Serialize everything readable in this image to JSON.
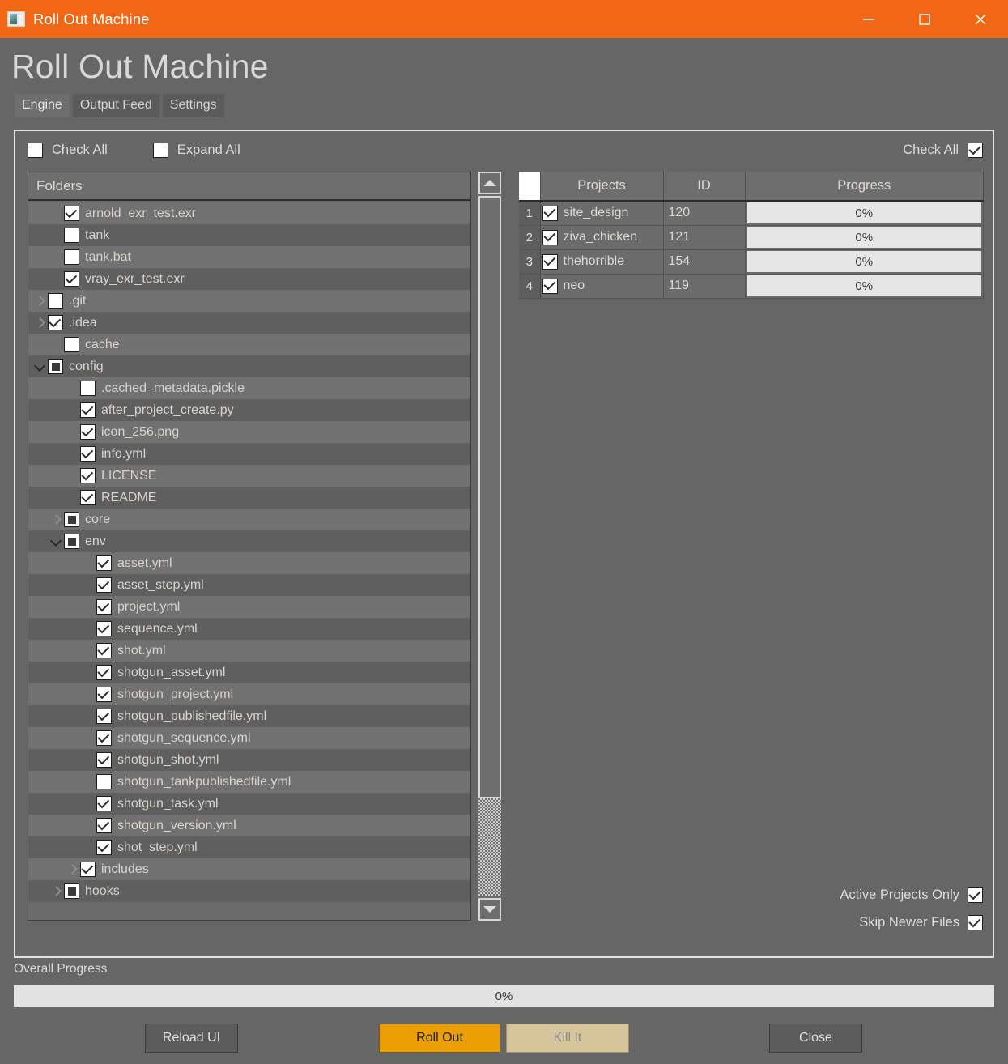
{
  "window": {
    "title": "Roll Out Machine",
    "icon": "app-window-icon",
    "controls": {
      "minimize": "minimize-icon",
      "maximize": "maximize-icon",
      "close": "close-icon"
    },
    "accent_color": "#f26716"
  },
  "header": {
    "app_title": "Roll Out Machine"
  },
  "tabs": [
    {
      "label": "Engine",
      "active": true
    },
    {
      "label": "Output Feed",
      "active": false
    },
    {
      "label": "Settings",
      "active": false
    }
  ],
  "left_panel": {
    "check_all_label": "Check All",
    "check_all_state": "unchecked",
    "expand_all_label": "Expand All",
    "expand_all_state": "unchecked",
    "tree_header": "Folders",
    "rows": [
      {
        "label": "arnold_exr_test.exr",
        "indent": 1,
        "arrow": "none",
        "check": "checked"
      },
      {
        "label": "tank",
        "indent": 1,
        "arrow": "none",
        "check": "unchecked"
      },
      {
        "label": "tank.bat",
        "indent": 1,
        "arrow": "none",
        "check": "unchecked"
      },
      {
        "label": "vray_exr_test.exr",
        "indent": 1,
        "arrow": "none",
        "check": "checked"
      },
      {
        "label": ".git",
        "indent": 0,
        "arrow": "right",
        "check": "unchecked"
      },
      {
        "label": ".idea",
        "indent": 0,
        "arrow": "right",
        "check": "checked"
      },
      {
        "label": "cache",
        "indent": 1,
        "arrow": "none",
        "check": "unchecked"
      },
      {
        "label": "config",
        "indent": 0,
        "arrow": "down",
        "check": "partial"
      },
      {
        "label": ".cached_metadata.pickle",
        "indent": 2,
        "arrow": "none",
        "check": "unchecked"
      },
      {
        "label": "after_project_create.py",
        "indent": 2,
        "arrow": "none",
        "check": "checked"
      },
      {
        "label": "icon_256.png",
        "indent": 2,
        "arrow": "none",
        "check": "checked"
      },
      {
        "label": "info.yml",
        "indent": 2,
        "arrow": "none",
        "check": "checked"
      },
      {
        "label": "LICENSE",
        "indent": 2,
        "arrow": "none",
        "check": "checked"
      },
      {
        "label": "README",
        "indent": 2,
        "arrow": "none",
        "check": "checked"
      },
      {
        "label": "core",
        "indent": 1,
        "arrow": "right",
        "check": "partial"
      },
      {
        "label": "env",
        "indent": 1,
        "arrow": "down",
        "check": "partial"
      },
      {
        "label": "asset.yml",
        "indent": 3,
        "arrow": "none",
        "check": "checked"
      },
      {
        "label": "asset_step.yml",
        "indent": 3,
        "arrow": "none",
        "check": "checked"
      },
      {
        "label": "project.yml",
        "indent": 3,
        "arrow": "none",
        "check": "checked"
      },
      {
        "label": "sequence.yml",
        "indent": 3,
        "arrow": "none",
        "check": "checked"
      },
      {
        "label": "shot.yml",
        "indent": 3,
        "arrow": "none",
        "check": "checked"
      },
      {
        "label": "shotgun_asset.yml",
        "indent": 3,
        "arrow": "none",
        "check": "checked"
      },
      {
        "label": "shotgun_project.yml",
        "indent": 3,
        "arrow": "none",
        "check": "checked"
      },
      {
        "label": "shotgun_publishedfile.yml",
        "indent": 3,
        "arrow": "none",
        "check": "checked"
      },
      {
        "label": "shotgun_sequence.yml",
        "indent": 3,
        "arrow": "none",
        "check": "checked"
      },
      {
        "label": "shotgun_shot.yml",
        "indent": 3,
        "arrow": "none",
        "check": "checked"
      },
      {
        "label": "shotgun_tankpublishedfile.yml",
        "indent": 3,
        "arrow": "none",
        "check": "unchecked"
      },
      {
        "label": "shotgun_task.yml",
        "indent": 3,
        "arrow": "none",
        "check": "checked"
      },
      {
        "label": "shotgun_version.yml",
        "indent": 3,
        "arrow": "none",
        "check": "checked"
      },
      {
        "label": "shot_step.yml",
        "indent": 3,
        "arrow": "none",
        "check": "checked"
      },
      {
        "label": "includes",
        "indent": 2,
        "arrow": "right",
        "check": "checked"
      },
      {
        "label": "hooks",
        "indent": 1,
        "arrow": "right",
        "check": "partial"
      }
    ],
    "scrollbar": {
      "up": "scroll-up-arrow",
      "down": "scroll-down-arrow"
    }
  },
  "right_panel": {
    "check_all_label": "Check All",
    "check_all_state": "checked",
    "columns": [
      "",
      "Projects",
      "ID",
      "Progress"
    ],
    "rows": [
      {
        "num": "1",
        "check": "checked",
        "project": "site_design",
        "id": "120",
        "progress": "0%"
      },
      {
        "num": "2",
        "check": "checked",
        "project": "ziva_chicken",
        "id": "121",
        "progress": "0%"
      },
      {
        "num": "3",
        "check": "checked",
        "project": "thehorrible",
        "id": "154",
        "progress": "0%"
      },
      {
        "num": "4",
        "check": "checked",
        "project": "neo",
        "id": "119",
        "progress": "0%"
      }
    ],
    "options": [
      {
        "label": "Active Projects Only",
        "state": "checked"
      },
      {
        "label": "Skip Newer Files",
        "state": "checked"
      }
    ]
  },
  "footer": {
    "overall_progress_label": "Overall Progress",
    "overall_progress_value": "0%",
    "buttons": {
      "reload": "Reload UI",
      "rollout": "Roll Out",
      "kill": "Kill It",
      "close": "Close"
    },
    "rollout_color": "#eb9f02",
    "kill_color": "#d6c49a"
  }
}
